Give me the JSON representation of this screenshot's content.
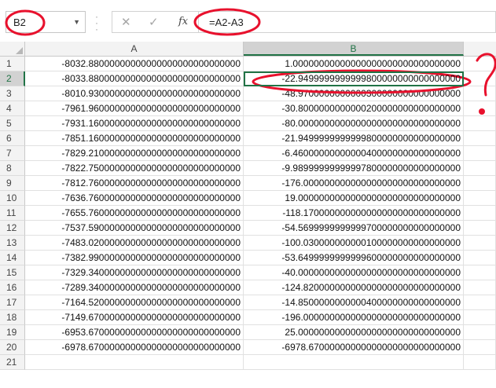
{
  "formula_bar": {
    "name_box": "B2",
    "formula": "=A2-A3",
    "cancel_icon": "✕",
    "enter_icon": "✓",
    "fx_icon": "fx"
  },
  "columns": [
    "A",
    "B",
    ""
  ],
  "rows": [
    {
      "n": "1",
      "a": "-8032.88000000000000000000000000000",
      "b": "1.00000000000000000000000000000000"
    },
    {
      "n": "2",
      "a": "-8033.88000000000000000000000000000",
      "b": "-22.9499999999999800000000000000000"
    },
    {
      "n": "3",
      "a": "-8010.93000000000000000000000000000",
      "b": "-48.9700000000000300000000000000000"
    },
    {
      "n": "4",
      "a": "-7961.96000000000000000000000000000",
      "b": "-30.8000000000000200000000000000000"
    },
    {
      "n": "5",
      "a": "-7931.16000000000000000000000000000",
      "b": "-80.0000000000000000000000000000000"
    },
    {
      "n": "6",
      "a": "-7851.16000000000000000000000000000",
      "b": "-21.9499999999999800000000000000000"
    },
    {
      "n": "7",
      "a": "-7829.21000000000000000000000000000",
      "b": "-6.46000000000000400000000000000000"
    },
    {
      "n": "8",
      "a": "-7822.75000000000000000000000000000",
      "b": "-9.98999999999997800000000000000000"
    },
    {
      "n": "9",
      "a": "-7812.76000000000000000000000000000",
      "b": "-176.000000000000000000000000000000"
    },
    {
      "n": "10",
      "a": "-7636.76000000000000000000000000000",
      "b": "19.0000000000000000000000000000000"
    },
    {
      "n": "11",
      "a": "-7655.76000000000000000000000000000",
      "b": "-118.170000000000000000000000000000"
    },
    {
      "n": "12",
      "a": "-7537.59000000000000000000000000000",
      "b": "-54.5699999999999700000000000000000"
    },
    {
      "n": "13",
      "a": "-7483.02000000000000000000000000000",
      "b": "-100.030000000000100000000000000000"
    },
    {
      "n": "14",
      "a": "-7382.99000000000000000000000000000",
      "b": "-53.6499999999999600000000000000000"
    },
    {
      "n": "15",
      "a": "-7329.34000000000000000000000000000",
      "b": "-40.0000000000000000000000000000000"
    },
    {
      "n": "16",
      "a": "-7289.34000000000000000000000000000",
      "b": "-124.820000000000000000000000000000"
    },
    {
      "n": "17",
      "a": "-7164.52000000000000000000000000000",
      "b": "-14.8500000000000400000000000000000"
    },
    {
      "n": "18",
      "a": "-7149.67000000000000000000000000000",
      "b": "-196.000000000000000000000000000000"
    },
    {
      "n": "19",
      "a": "-6953.67000000000000000000000000000",
      "b": "25.0000000000000000000000000000000"
    },
    {
      "n": "20",
      "a": "-6978.67000000000000000000000000000",
      "b": "-6978.67000000000000000000000000000"
    },
    {
      "n": "21",
      "a": "",
      "b": ""
    }
  ],
  "colors": {
    "annotation_red": "#e8112d",
    "excel_green": "#217346"
  }
}
